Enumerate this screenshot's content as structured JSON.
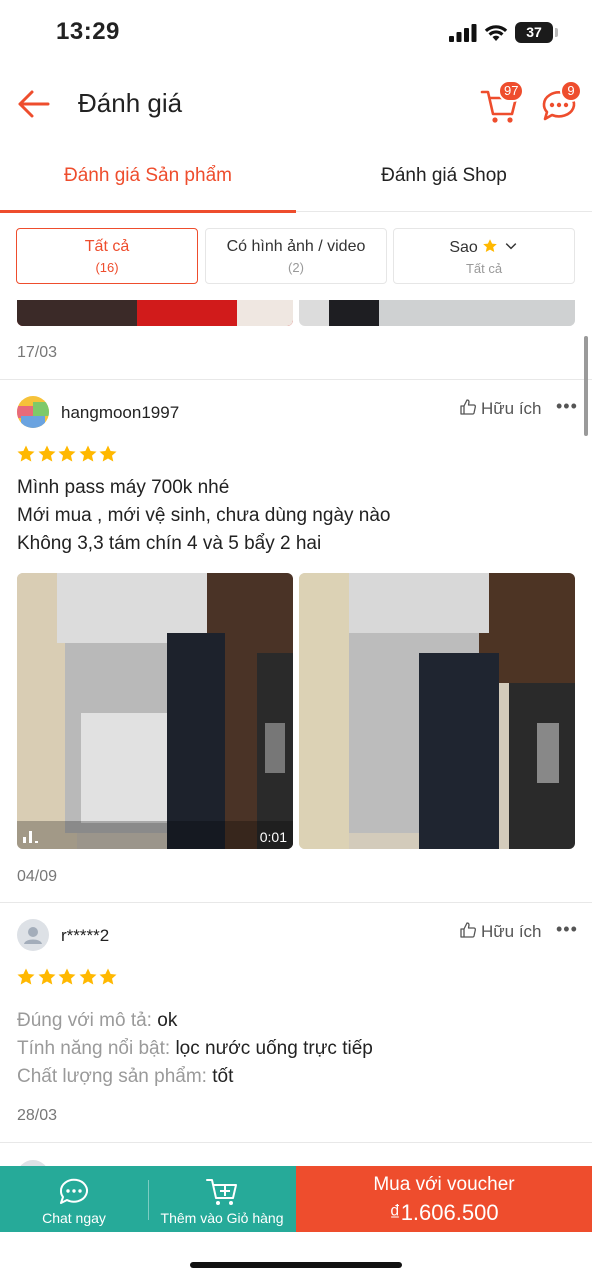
{
  "status_bar": {
    "time": "13:29",
    "battery": "37"
  },
  "header": {
    "title": "Đánh giá",
    "cart_badge": "97",
    "chat_badge": "9"
  },
  "tabs": [
    {
      "label": "Đánh giá Sản phẩm"
    },
    {
      "label": "Đánh giá Shop"
    }
  ],
  "filters": [
    {
      "label": "Tất cả",
      "count": "(16)"
    },
    {
      "label": "Có hình ảnh / video",
      "count": "(2)"
    },
    {
      "label": "Sao",
      "sub": "Tất cả"
    }
  ],
  "reviews": [
    {
      "date": "17/03"
    },
    {
      "username": "hangmoon1997",
      "rating": 5,
      "helpful": "Hữu ích",
      "lines": [
        "Mình pass máy 700k nhé",
        "Mới mua , mới vệ sinh, chưa dùng ngày nào",
        "Không 3,3 tám chín 4 và 5 bẩy 2 hai"
      ],
      "video_duration": "0:01",
      "date": "04/09"
    },
    {
      "username": "r*****2",
      "rating": 5,
      "helpful": "Hữu ích",
      "attributes": [
        {
          "key": "Đúng với mô tả:",
          "value": "ok"
        },
        {
          "key": "Tính năng nổi bật:",
          "value": "lọc nước uống trực tiếp"
        },
        {
          "key": "Chất lượng sản phẩm:",
          "value": "tốt"
        }
      ],
      "date": "28/03"
    }
  ],
  "bottom_bar": {
    "chat": "Chat ngay",
    "add_cart": "Thêm vào Giỏ hàng",
    "buy_label": "Mua với voucher",
    "buy_price": "₫1.606.500"
  },
  "colors": {
    "brand": "#ee4d2d",
    "teal": "#26aa99",
    "star": "#ffb800"
  }
}
